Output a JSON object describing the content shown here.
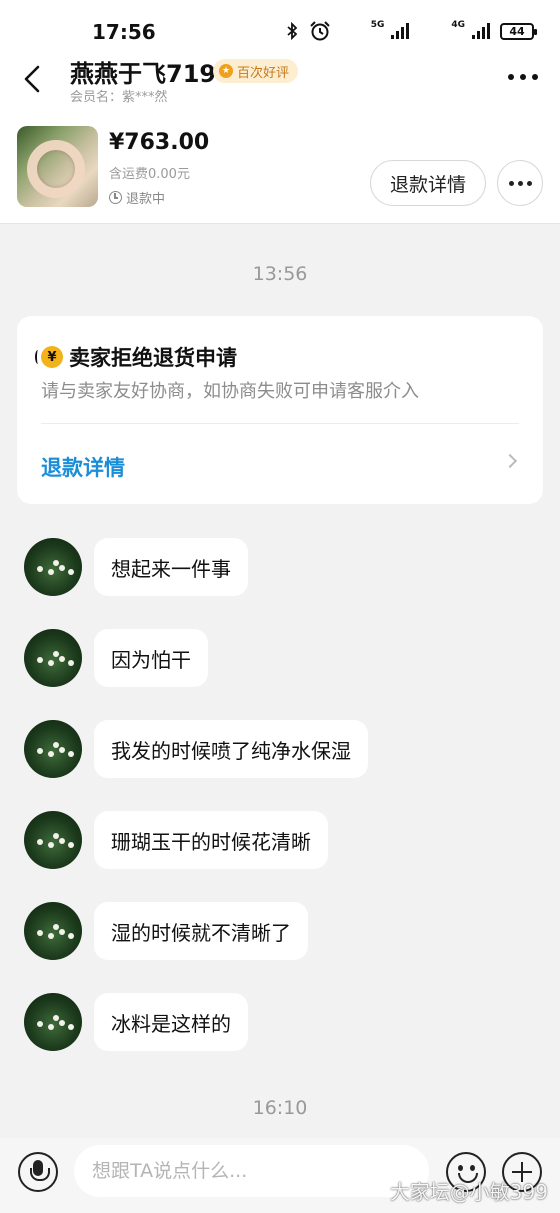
{
  "status_bar": {
    "time": "17:56",
    "net1": "5G",
    "net2": "4G",
    "battery": "44",
    "icons": [
      "bluetooth-icon",
      "alarm-icon",
      "signal-icon",
      "signal-icon",
      "battery-icon"
    ]
  },
  "header": {
    "shop_name": "燕燕于飞719",
    "badge": "百次好评",
    "member": "会员名：紫***然",
    "back_icon": "back-arrow-icon",
    "more_icon": "more-dots-icon"
  },
  "product": {
    "price": "¥763.00",
    "shipping": "含运费0.00元",
    "status": "退款中",
    "refund_button": "退款详情"
  },
  "chat": {
    "timestamp1": "13:56",
    "notice": {
      "title": "卖家拒绝退货申请",
      "desc": "请与卖家友好协商，如协商失败可申请客服介入",
      "link": "退款详情"
    },
    "messages": [
      "想起来一件事",
      "因为怕干",
      "我发的时候喷了纯净水保湿",
      "珊瑚玉干的时候花清晰",
      "湿的时候就不清晰了",
      "冰料是这样的"
    ],
    "timestamp2": "16:10"
  },
  "input_bar": {
    "placeholder": "想跟TA说点什么..."
  },
  "watermark": "大家坛@小敏399",
  "colors": {
    "link_blue": "#1b8ed8",
    "badge_bg": "#fdeed2",
    "badge_text": "#c8781a",
    "background": "#f2f2f2"
  }
}
